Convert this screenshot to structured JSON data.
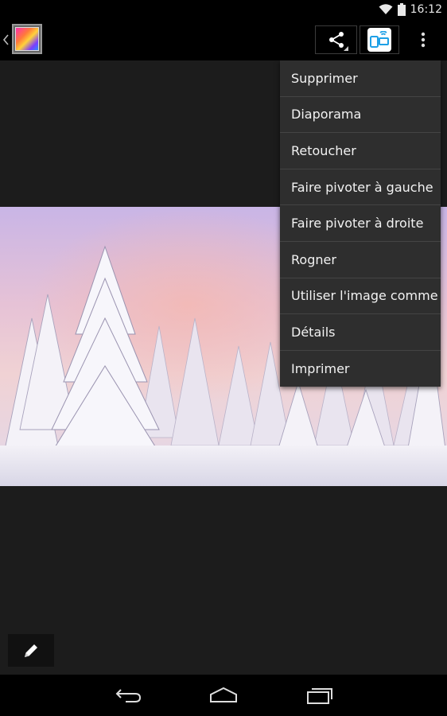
{
  "status_bar": {
    "time": "16:12",
    "icons": [
      "wifi-icon",
      "battery-icon"
    ]
  },
  "action_bar": {
    "icons": [
      "up-chevron-icon",
      "gallery-app-icon",
      "share-icon",
      "cast-icon",
      "overflow-menu-icon"
    ]
  },
  "menu": {
    "items": [
      {
        "label": "Supprimer"
      },
      {
        "label": "Diaporama"
      },
      {
        "label": "Retoucher"
      },
      {
        "label": "Faire pivoter à gauche"
      },
      {
        "label": "Faire pivoter à droite"
      },
      {
        "label": "Rogner"
      },
      {
        "label": "Utiliser l'image comme"
      },
      {
        "label": "Détails"
      },
      {
        "label": "Imprimer"
      }
    ]
  },
  "bottom": {
    "icons": [
      "pencil-icon"
    ]
  },
  "nav_bar": {
    "icons": [
      "back-icon",
      "home-icon",
      "recent-apps-icon"
    ]
  },
  "colors": {
    "background": "#1c1c1c",
    "bar": "#000000",
    "menu": "#2e2e2e",
    "cast_accent": "#1ea0e6"
  }
}
